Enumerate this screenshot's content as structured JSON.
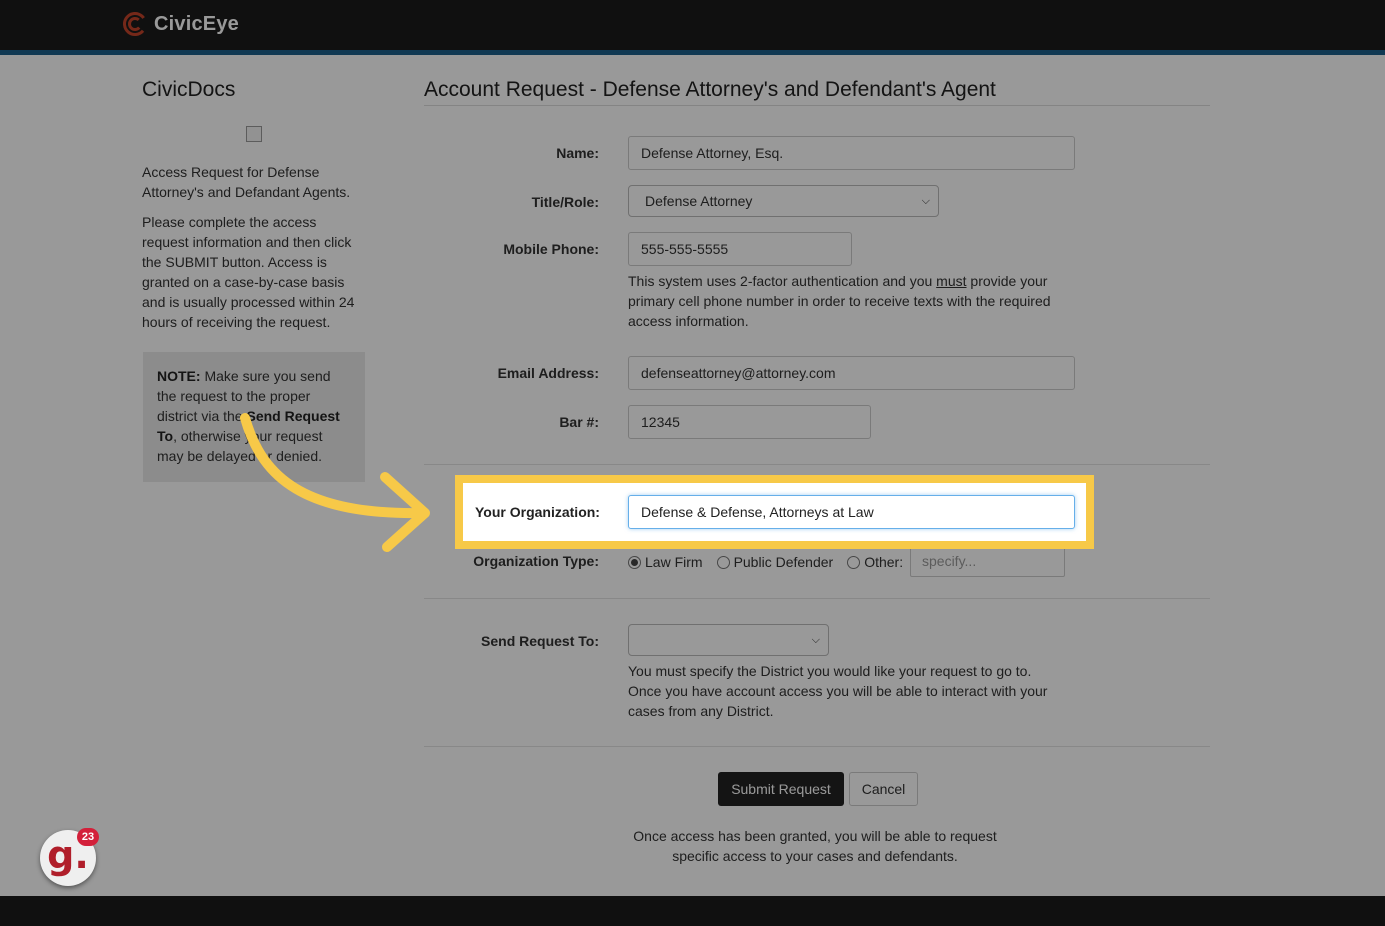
{
  "brand": {
    "name": "CivicEye",
    "accent": "#c4442a"
  },
  "sidebar": {
    "title": "CivicDocs",
    "intro": "Access Request for Defense Attorney's and Defandant Agents.",
    "instructions": "Please complete the access request information and then click the SUBMIT button. Access is granted on a case-by-case basis and is usually processed within 24 hours of receiving the request.",
    "note": {
      "prefix": "NOTE:",
      "text_a": " Make sure you send the request to the proper district via the ",
      "bold_b": "Send Request To",
      "text_c": ", otherwise your request may be delayed or denied."
    }
  },
  "form": {
    "title": "Account Request - Defense Attorney's and Defendant's Agent",
    "name": {
      "label": "Name:",
      "value": "Defense Attorney, Esq."
    },
    "title_role": {
      "label": "Title/Role:",
      "value": "Defense Attorney"
    },
    "mobile": {
      "label": "Mobile Phone:",
      "value": "555-555-5555",
      "help_a": "This system uses 2-factor authentication and you ",
      "help_must": "must",
      "help_b": " provide your primary cell phone number in order to receive texts with the required access information."
    },
    "email": {
      "label": "Email Address:",
      "value": "defenseattorney@attorney.com"
    },
    "bar": {
      "label": "Bar #:",
      "value": "12345"
    },
    "organization": {
      "label": "Your Organization:",
      "value": "Defense & Defense, Attorneys at Law"
    },
    "org_type": {
      "label": "Organization Type:",
      "options": [
        "Law Firm",
        "Public Defender",
        "Other:"
      ],
      "selected": "Law Firm",
      "other_placeholder": "specify..."
    },
    "send_to": {
      "label": "Send Request To:",
      "value": "",
      "help": "You must specify the District you would like your request to go to. Once you have account access you will be able to interact with your cases from any District."
    },
    "submit_label": "Submit Request",
    "cancel_label": "Cancel",
    "footer": "Once access has been granted, you will be able to request specific access to your cases and defendants."
  },
  "overlay": {
    "highlight_color": "#f7c948"
  },
  "widget": {
    "letter": "g.",
    "count": "23"
  }
}
